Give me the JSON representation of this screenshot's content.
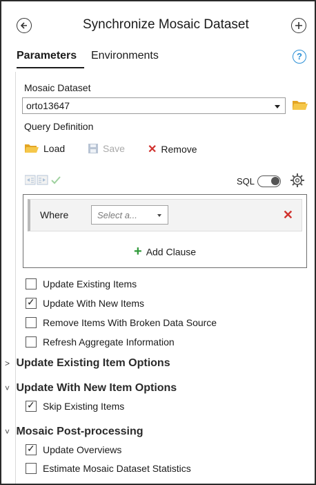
{
  "header": {
    "title": "Synchronize Mosaic Dataset",
    "back_icon": "back-circle-arrow-icon",
    "add_icon": "add-circle-icon"
  },
  "tabs": [
    {
      "label": "Parameters",
      "active": true
    },
    {
      "label": "Environments",
      "active": false
    }
  ],
  "help_symbol": "?",
  "mosaic_dataset": {
    "label": "Mosaic Dataset",
    "value": "orto13647"
  },
  "query_definition": {
    "label": "Query Definition",
    "load_label": "Load",
    "save_label": "Save",
    "remove_label": "Remove",
    "sql_label": "SQL",
    "sql_enabled": false
  },
  "clause": {
    "where_label": "Where",
    "field_placeholder": "Select a...",
    "add_clause_label": "Add Clause"
  },
  "options": [
    {
      "label": "Update Existing Items",
      "checked": false
    },
    {
      "label": "Update With New Items",
      "checked": true
    },
    {
      "label": "Remove Items With Broken Data Source",
      "checked": false
    },
    {
      "label": "Refresh Aggregate Information",
      "checked": false
    }
  ],
  "sections": {
    "update_existing": {
      "title": "Update Existing Item Options",
      "expanded": false
    },
    "update_new": {
      "title": "Update With New Item Options",
      "expanded": true,
      "items": [
        {
          "label": "Skip Existing Items",
          "checked": true
        }
      ]
    },
    "post_processing": {
      "title": "Mosaic Post-processing",
      "expanded": true,
      "items": [
        {
          "label": "Update Overviews",
          "checked": true
        },
        {
          "label": "Estimate Mosaic Dataset Statistics",
          "checked": false
        }
      ]
    }
  },
  "colors": {
    "accent_blue": "#2a8fd6",
    "remove_red": "#d0312d",
    "add_green": "#2f9a3a",
    "folder_yellow": "#f0b93a"
  }
}
